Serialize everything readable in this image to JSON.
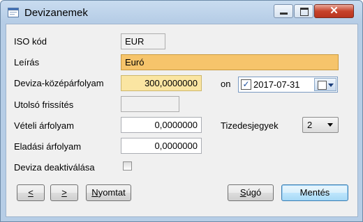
{
  "window": {
    "title": "Devizanemek",
    "controls": {
      "minimize": "minimize",
      "maximize": "maximize",
      "close": "✕"
    }
  },
  "form": {
    "iso": {
      "label": "ISO kód",
      "value": "EUR"
    },
    "leiras": {
      "label": "Leírás",
      "value": "Euró"
    },
    "kozeparfolyam": {
      "label": "Deviza-középárfolyam",
      "value": "300,0000000"
    },
    "on_label": "on",
    "date": {
      "checked_glyph": "✓",
      "value": "2017-07-31"
    },
    "utolso_frissites": {
      "label": "Utolsó frissítés",
      "value": ""
    },
    "veteli": {
      "label": "Vételi árfolyam",
      "value": "0,0000000"
    },
    "tizedesjegyek": {
      "label": "Tizedesjegyek",
      "value": "2"
    },
    "eladasi": {
      "label": "Eladási árfolyam",
      "value": "0,0000000"
    },
    "deaktivalas": {
      "label": "Deviza deaktiválása",
      "checked": false
    }
  },
  "buttons": {
    "prev": "<",
    "next": ">",
    "print": "Nyomtat",
    "help": "Súgó",
    "save": "Mentés"
  },
  "icons": {
    "app": "window-app-icon",
    "calendar": "calendar-icon",
    "dropdown": "chevron-down-icon"
  }
}
